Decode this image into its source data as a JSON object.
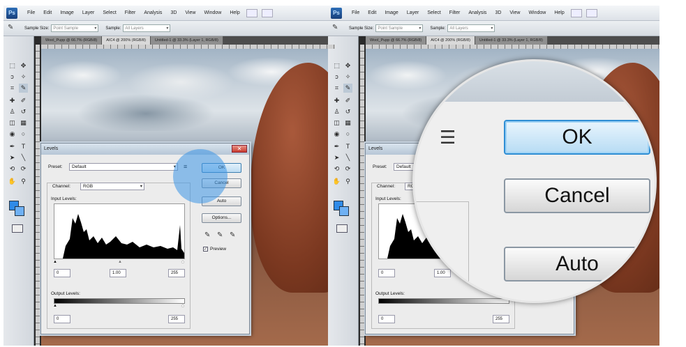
{
  "menu": {
    "logo": "Ps",
    "items": [
      "File",
      "Edit",
      "Image",
      "Layer",
      "Select",
      "Filter",
      "Analysis",
      "3D",
      "View",
      "Window",
      "Help"
    ]
  },
  "options": {
    "sample_size_label": "Sample Size:",
    "sample_size_value": "Point Sample",
    "sample_label": "Sample:",
    "sample_value": "All Layers"
  },
  "tabs": {
    "left": [
      "Wool_Pupp @ 66.7% (RGB/8)",
      "AIC4 @ 200% (RGB/8)",
      "Untitled-1 @ 33.3% (Layer 1, RGB/8)"
    ],
    "right": [
      "Wool_Pupp @ 66.7% (RGB/8)",
      "AIC4 @ 200% (RGB/8)",
      "Untitled-1 @ 33.3% (Layer 1, RGB/8)"
    ]
  },
  "levels": {
    "title": "Levels",
    "close": "✕",
    "preset_label": "Preset:",
    "preset_value": "Default",
    "channel_label": "Channel:",
    "channel_value": "RGB",
    "input_levels": "Input Levels:",
    "input_black": "0",
    "input_gamma": "1.00",
    "input_white": "255",
    "output_levels": "Output Levels:",
    "output_black": "0",
    "output_white": "255",
    "ok": "OK",
    "cancel": "Cancel",
    "auto": "Auto",
    "options": "Options...",
    "preview": "Preview"
  },
  "magnifier": {
    "ok": "OK",
    "cancel": "Cancel",
    "auto": "Auto"
  },
  "colors": {
    "foreground": "#2f8be8",
    "background": "#6fb1f4",
    "highlight": "#3c96e6"
  }
}
